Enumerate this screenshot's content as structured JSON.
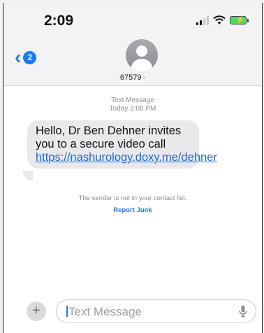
{
  "status": {
    "time": "2:09"
  },
  "nav": {
    "back_badge": "2",
    "contact": "67579"
  },
  "thread": {
    "type": "Text Message",
    "timestamp": "Today 2:08 PM",
    "message_text": "Hello, Dr Ben Dehner invites you to a secure video call",
    "message_link": "https://nashurology.doxy.me/dehner",
    "notice": "The sender is not in your contact list.",
    "report": "Report Junk"
  },
  "compose": {
    "placeholder": "Text Message"
  },
  "colors": {
    "accent": "#1a7cf5",
    "bubble": "#e9e9eb",
    "battery": "#4cd964"
  }
}
